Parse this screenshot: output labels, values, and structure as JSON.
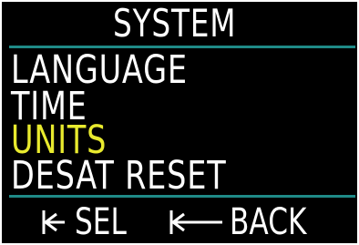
{
  "screen": {
    "title": "SYSTEM",
    "menu_items": [
      {
        "label": "LANGUAGE",
        "selected": false
      },
      {
        "label": "TIME",
        "selected": false
      },
      {
        "label": "UNITS",
        "selected": true
      },
      {
        "label": "DESAT RESET",
        "selected": false
      }
    ],
    "footer": {
      "select_label": "SEL",
      "select_icon": "short-arrow-left-icon",
      "back_label": "BACK",
      "back_icon": "long-arrow-left-icon"
    }
  },
  "colors": {
    "background": "#000000",
    "text": "#ffffff",
    "selected_text": "#e8ea2e",
    "divider": "#1f8a87"
  }
}
